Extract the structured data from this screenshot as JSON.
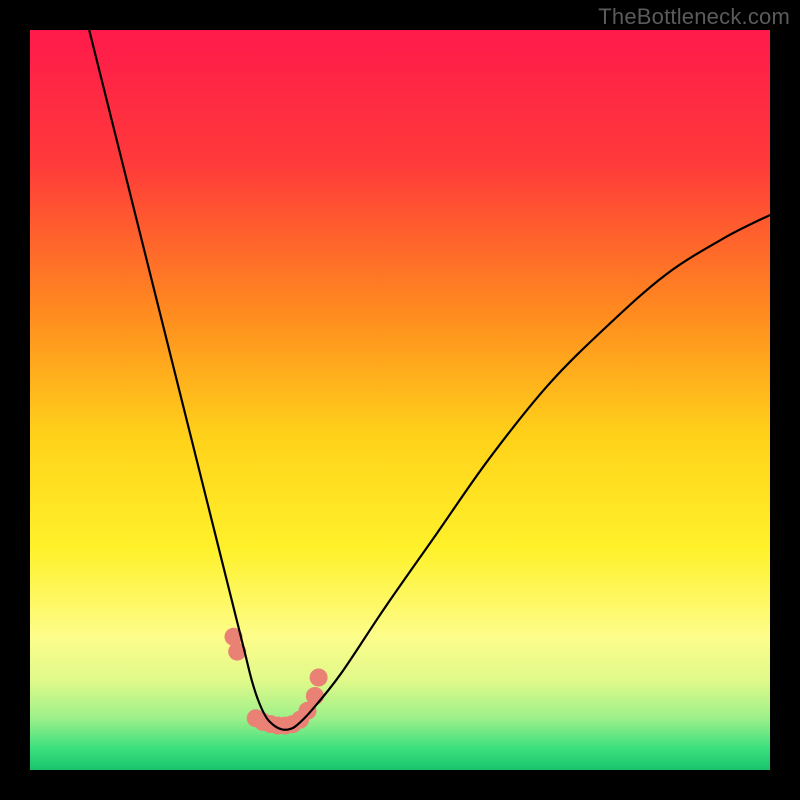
{
  "watermark": "TheBottleneck.com",
  "chart_data": {
    "type": "line",
    "title": "",
    "xlabel": "",
    "ylabel": "",
    "xlim": [
      0,
      100
    ],
    "ylim": [
      0,
      100
    ],
    "grid": false,
    "legend": false,
    "background_gradient_stops": [
      {
        "offset": 0.0,
        "color": "#ff1a4b"
      },
      {
        "offset": 0.18,
        "color": "#ff3a3a"
      },
      {
        "offset": 0.38,
        "color": "#ff8a1f"
      },
      {
        "offset": 0.55,
        "color": "#ffd21a"
      },
      {
        "offset": 0.7,
        "color": "#fff12a"
      },
      {
        "offset": 0.82,
        "color": "#fdfd8a"
      },
      {
        "offset": 0.88,
        "color": "#dff98a"
      },
      {
        "offset": 0.93,
        "color": "#9df08a"
      },
      {
        "offset": 0.97,
        "color": "#3de07e"
      },
      {
        "offset": 1.0,
        "color": "#18c46c"
      }
    ],
    "series": [
      {
        "name": "bottleneck-curve",
        "color": "#000000",
        "x": [
          8,
          10,
          12,
          14,
          16,
          18,
          20,
          22,
          24,
          26,
          27,
          28,
          29,
          30,
          31,
          32,
          33,
          34,
          35,
          36,
          38,
          42,
          48,
          55,
          62,
          70,
          78,
          86,
          94,
          100
        ],
        "values": [
          100,
          92,
          84,
          76,
          68,
          60,
          52,
          44,
          36,
          28,
          24,
          20,
          16,
          12,
          9,
          7,
          6,
          5.5,
          5.5,
          6,
          8,
          13,
          22,
          32,
          42,
          52,
          60,
          67,
          72,
          75
        ]
      }
    ],
    "markers": {
      "name": "highlight-points",
      "color": "#e98274",
      "radius_px": 9,
      "x": [
        27.5,
        28.0,
        30.5,
        31.5,
        32.5,
        33.5,
        34.5,
        35.5,
        36.5,
        37.5,
        38.5,
        39.0
      ],
      "values": [
        18.0,
        16.0,
        7.0,
        6.5,
        6.2,
        6.0,
        6.0,
        6.2,
        6.8,
        8.0,
        10.0,
        12.5
      ]
    }
  }
}
